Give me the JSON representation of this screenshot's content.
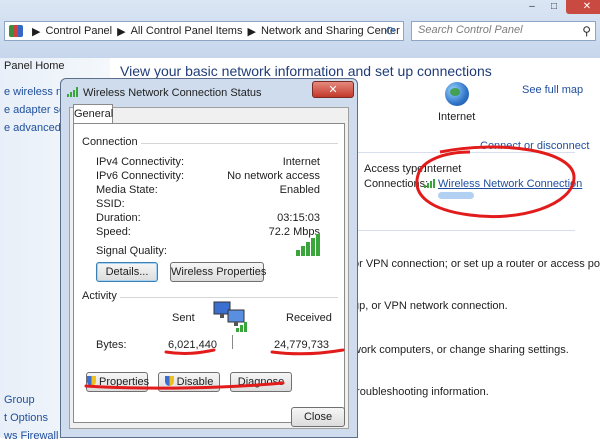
{
  "address": {
    "crumbs": [
      "Control Panel",
      "All Control Panel Items",
      "Network and Sharing Center"
    ],
    "search_placeholder": "Search Control Panel",
    "window_buttons": [
      "–",
      "□",
      "✕"
    ]
  },
  "leftnav": {
    "items": [
      "Panel Home",
      "e wireless netw",
      "e adapter settin",
      "e advanced sha",
      "Group",
      "t Options",
      "ws Firewall"
    ]
  },
  "main": {
    "heading": "View your basic network information and set up connections",
    "see_full_map": "See full map",
    "internet_label": "Internet",
    "connect_or_disconnect": "Connect or disconnect",
    "access_type_label": "Access type:",
    "access_type_value": "Internet",
    "connections_label": "Connections:",
    "connections_value": "Wireless Network Connection",
    "lines": [
      "or VPN connection; or set up a router or access point.",
      "up, or VPN network connection.",
      "work computers, or change sharing settings.",
      "troubleshooting information."
    ]
  },
  "dialog": {
    "title": "Wireless Network Connection Status",
    "close_glyph": "✕",
    "tab": "General",
    "connection_group": "Connection",
    "rows": [
      {
        "label": "IPv4 Connectivity:",
        "value": "Internet"
      },
      {
        "label": "IPv6 Connectivity:",
        "value": "No network access"
      },
      {
        "label": "Media State:",
        "value": "Enabled"
      },
      {
        "label": "SSID:",
        "value": ""
      },
      {
        "label": "Duration:",
        "value": "03:15:03"
      },
      {
        "label": "Speed:",
        "value": "72.2 Mbps"
      }
    ],
    "signal_quality_label": "Signal Quality:",
    "details_button": "Details...",
    "wireless_properties_button": "Wireless Properties",
    "activity_group": "Activity",
    "sent_label": "Sent",
    "received_label": "Received",
    "bytes_label": "Bytes:",
    "bytes_sent": "6,021,440",
    "bytes_received": "24,779,733",
    "properties_button": "Properties",
    "disable_button": "Disable",
    "diagnose_button": "Diagnose",
    "close_button": "Close"
  },
  "colors": {
    "annotation": "#e21b1b",
    "link": "#1f4f9c",
    "heading": "#1f3c78",
    "signal": "#3aa53a"
  }
}
